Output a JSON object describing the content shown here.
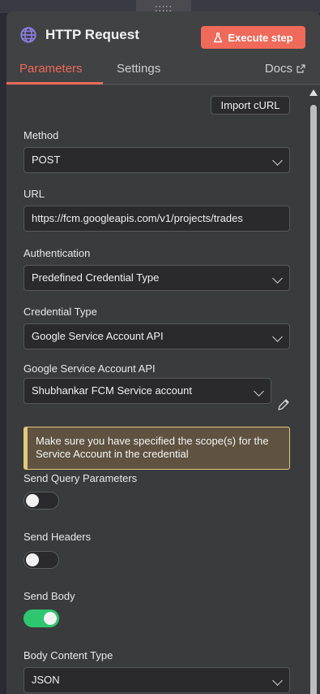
{
  "drag_handle": ":::::",
  "header": {
    "title": "HTTP Request",
    "execute_label": "Execute step",
    "icon": "globe-icon"
  },
  "tabs": {
    "parameters": "Parameters",
    "settings": "Settings",
    "docs": "Docs"
  },
  "import_curl": "Import cURL",
  "fields": {
    "method": {
      "label": "Method",
      "value": "POST"
    },
    "url": {
      "label": "URL",
      "value": "https://fcm.googleapis.com/v1/projects/trades"
    },
    "authentication": {
      "label": "Authentication",
      "value": "Predefined Credential Type"
    },
    "credential_type": {
      "label": "Credential Type",
      "value": "Google Service Account API"
    },
    "google_sa": {
      "label": "Google Service Account API",
      "value": "Shubhankar FCM Service account"
    },
    "body_content_type": {
      "label": "Body Content Type",
      "value": "JSON"
    }
  },
  "notice": "Make sure you have specified the scope(s) for the Service Account in the credential",
  "toggles": {
    "query": {
      "label": "Send Query Parameters",
      "on": false
    },
    "headers": {
      "label": "Send Headers",
      "on": false
    },
    "body": {
      "label": "Send Body",
      "on": true
    }
  },
  "colors": {
    "accent": "#ef6a5a",
    "toggle_on": "#2ec66e",
    "notice_border": "#e3c77c"
  }
}
